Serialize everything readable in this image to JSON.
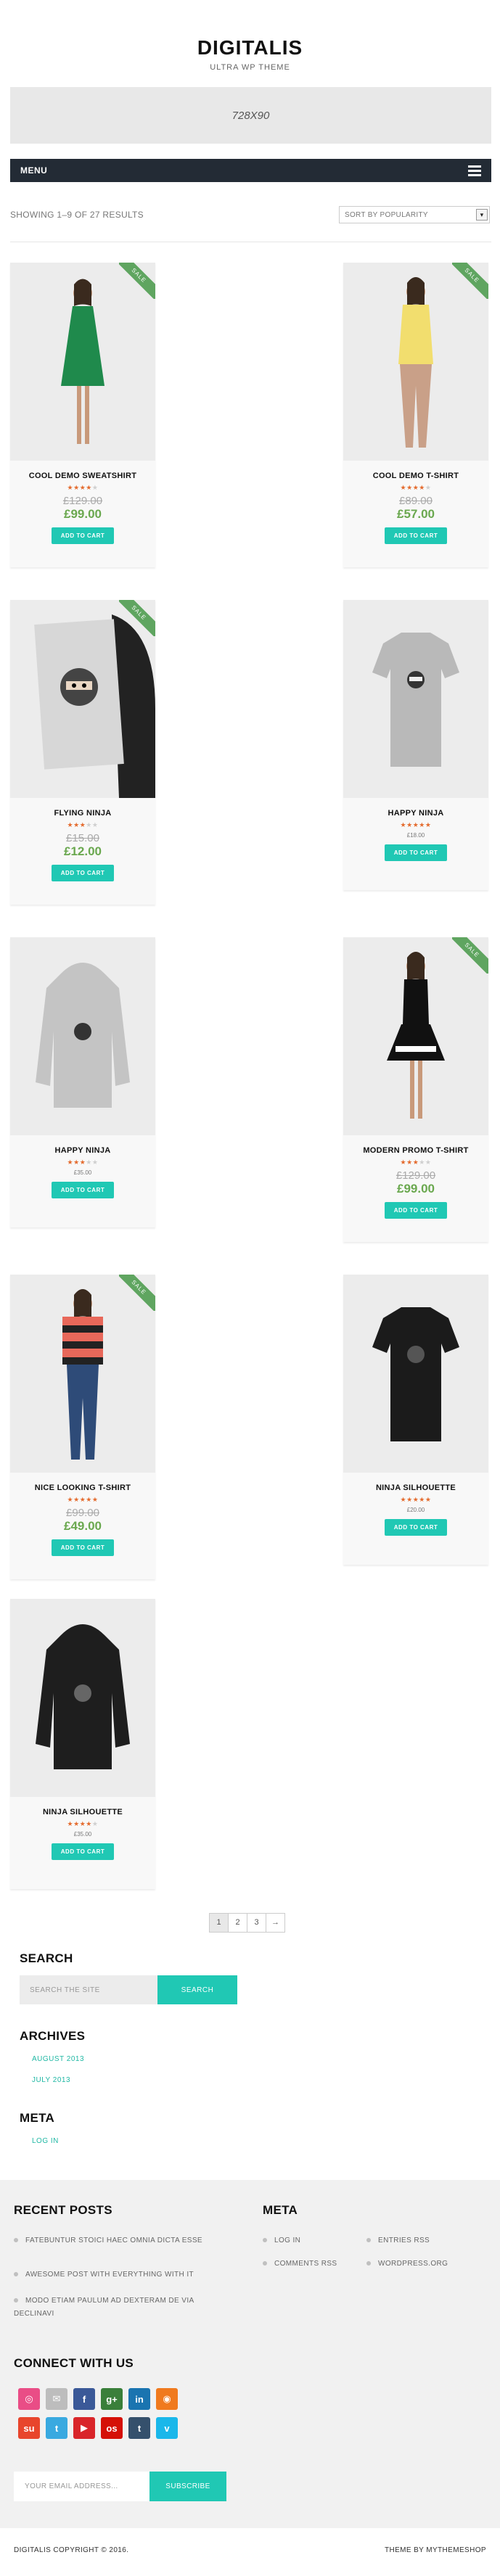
{
  "site": {
    "title": "DIGITALIS",
    "tagline": "ULTRA WP THEME",
    "ad_label": "728X90"
  },
  "nav": {
    "label": "MENU"
  },
  "shop": {
    "result_count": "SHOWING 1–9 OF 27 RESULTS",
    "sort_value": "SORT BY POPULARITY",
    "add_to_cart": "ADD TO CART",
    "sale_label": "SALE"
  },
  "products": [
    {
      "title": "COOL DEMO SWEATSHIRT",
      "rating": 4,
      "old_price": "£129.00",
      "price": "£99.00",
      "sale": true
    },
    {
      "title": "COOL DEMO T-SHIRT",
      "rating": 4,
      "old_price": "£89.00",
      "price": "£57.00",
      "sale": true
    },
    {
      "title": "FLYING NINJA",
      "rating": 3,
      "old_price": "£15.00",
      "price": "£12.00",
      "sale": true
    },
    {
      "title": "HAPPY NINJA",
      "rating": 5,
      "old_price": "",
      "price": "£18.00",
      "sale": false
    },
    {
      "title": "HAPPY NINJA",
      "rating": 3,
      "old_price": "",
      "price": "£35.00",
      "sale": false
    },
    {
      "title": "MODERN PROMO T-SHIRT",
      "rating": 3,
      "old_price": "£129.00",
      "price": "£99.00",
      "sale": true
    },
    {
      "title": "NICE LOOKING T-SHIRT",
      "rating": 5,
      "old_price": "£99.00",
      "price": "£49.00",
      "sale": true
    },
    {
      "title": "NINJA SILHOUETTE",
      "rating": 5,
      "old_price": "",
      "price": "£20.00",
      "sale": false
    },
    {
      "title": "NINJA SILHOUETTE",
      "rating": 4,
      "old_price": "",
      "price": "£35.00",
      "sale": false
    }
  ],
  "pagination": {
    "pages": [
      "1",
      "2",
      "3",
      "→"
    ]
  },
  "sidebar": {
    "search_title": "SEARCH",
    "search_placeholder": "SEARCH THE SITE",
    "search_button": "SEARCH",
    "archives_title": "ARCHIVES",
    "archives": [
      "AUGUST 2013",
      "JULY 2013"
    ],
    "meta_title": "META",
    "meta_links": [
      "LOG IN"
    ]
  },
  "footer": {
    "recent_title": "RECENT POSTS",
    "recent_posts": [
      "FATEBUNTUR STOICI HAEC OMNIA DICTA ESSE",
      "AWESOME POST WITH EVERYTHING WITH IT",
      "MODO ETIAM PAULUM AD DEXTERAM DE VIA DECLINAVI"
    ],
    "meta_title": "META",
    "meta_col1": [
      "LOG IN",
      "COMMENTS RSS"
    ],
    "meta_col2": [
      "ENTRIES RSS",
      "WORDPRESS.ORG"
    ],
    "connect_title": "CONNECT WITH US",
    "social_row1": [
      {
        "name": "dribbble-icon",
        "color": "#e94d86",
        "glyph": "◎"
      },
      {
        "name": "mail-icon",
        "color": "#bdbdbd",
        "glyph": "✉"
      },
      {
        "name": "facebook-icon",
        "color": "#3b5998",
        "glyph": "f"
      },
      {
        "name": "google-plus-icon",
        "color": "#3a7f3a",
        "glyph": "g+"
      },
      {
        "name": "linkedin-icon",
        "color": "#1a74b0",
        "glyph": "in"
      },
      {
        "name": "rss-icon",
        "color": "#f07a1e",
        "glyph": "◉"
      }
    ],
    "social_row2": [
      {
        "name": "stumbleupon-icon",
        "color": "#e8452c",
        "glyph": "su"
      },
      {
        "name": "twitter-icon",
        "color": "#39a9e0",
        "glyph": "t"
      },
      {
        "name": "youtube-icon",
        "color": "#d9252a",
        "glyph": "▶"
      },
      {
        "name": "lastfm-icon",
        "color": "#d51007",
        "glyph": "os"
      },
      {
        "name": "tumblr-icon",
        "color": "#35506c",
        "glyph": "t"
      },
      {
        "name": "vimeo-icon",
        "color": "#1ab7ea",
        "glyph": "v"
      }
    ],
    "email_placeholder": "YOUR EMAIL ADDRESS...",
    "subscribe_label": "SUBSCRIBE",
    "copyright": "DIGITALIS COPYRIGHT © 2016.",
    "credit": "THEME BY MYTHEMESHOP"
  }
}
